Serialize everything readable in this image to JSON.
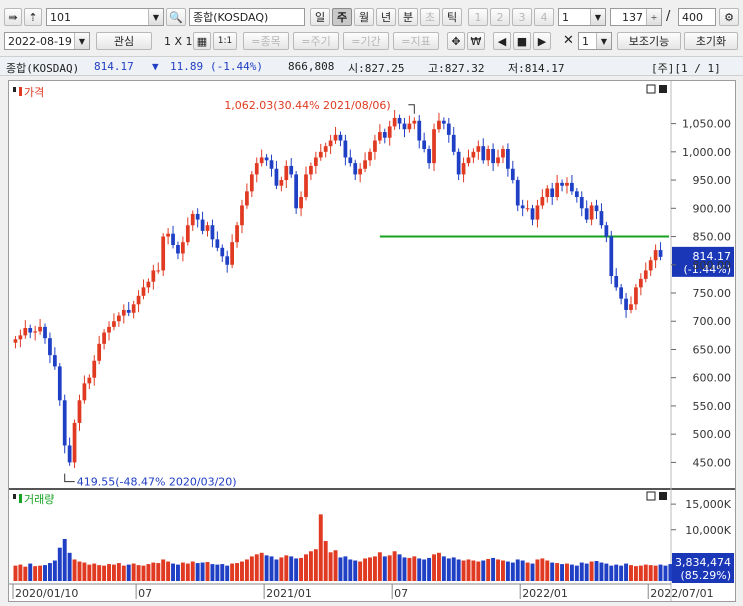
{
  "toolbar": {
    "code": "101",
    "name": "종합(KOSDAQ)",
    "periods": [
      "일",
      "주",
      "월",
      "년",
      "분",
      "초",
      "틱"
    ],
    "active_period": "주",
    "numbers": [
      "1",
      "2",
      "3",
      "4"
    ],
    "n_select": "1",
    "count": "137",
    "total": "400",
    "date": "2022-08-19",
    "watch_label": "관심",
    "grid_label": "1 X 1",
    "one_to_one": "1:1",
    "filter_buttons": [
      "=종목",
      "=주기",
      "=기간",
      "=지표"
    ],
    "x_select": "1",
    "aux_button": "보조기능",
    "reset_button": "초기화"
  },
  "info": {
    "name": "종합(KOSDAQ)",
    "price": "814.17",
    "arrow": "▼",
    "change": "11.89",
    "change_pct": "(-1.44%)",
    "volume": "866,808",
    "open": "시:827.25",
    "high": "고:827.32",
    "low": "저:814.17",
    "page": "[주][1 / 1]"
  },
  "price_panel": {
    "title": "가격"
  },
  "volume_panel": {
    "title": "거래량"
  },
  "colors": {
    "up": "#e03a22",
    "down": "#1f3fc4",
    "hline": "#15a321",
    "label_bg": "#1a37b8"
  },
  "chart_data": {
    "type": "candlestick",
    "title": "가격",
    "ylim": [
      410,
      1090
    ],
    "yticks": [
      450,
      500,
      550,
      600,
      650,
      700,
      750,
      800,
      850,
      900,
      950,
      1000,
      1050
    ],
    "ytick_labels": [
      "450.00",
      "500.00",
      "550.00",
      "600.00",
      "650.00",
      "700.00",
      "750.00",
      "800.00",
      "850.00",
      "900.00",
      "950.00",
      "1,000.00",
      "1,050.00"
    ],
    "x_labels": [
      {
        "index": 0,
        "label": "2020/01/10"
      },
      {
        "index": 25,
        "label": "07"
      },
      {
        "index": 51,
        "label": "2021/01"
      },
      {
        "index": 77,
        "label": "07"
      },
      {
        "index": 103,
        "label": "2022/01"
      },
      {
        "index": 129,
        "label": "2022/07/01"
      }
    ],
    "annotations": [
      {
        "text": "1,062.03(30.44% 2021/08/06)",
        "index": 81,
        "value": 1062.03
      },
      {
        "text": "419.55(-48.47% 2020/03/20)",
        "index": 10,
        "value": 419.55
      }
    ],
    "horizontal_line": 850,
    "last_price_label": "814.17",
    "last_change_label": "(-1.44%)",
    "close": [
      668,
      675,
      688,
      680,
      682,
      690,
      670,
      640,
      620,
      560,
      480,
      450,
      520,
      560,
      590,
      600,
      630,
      660,
      680,
      690,
      700,
      710,
      720,
      715,
      730,
      745,
      760,
      770,
      790,
      790,
      850,
      855,
      835,
      820,
      840,
      870,
      890,
      880,
      860,
      870,
      845,
      830,
      815,
      800,
      840,
      870,
      905,
      930,
      960,
      980,
      990,
      985,
      970,
      940,
      950,
      975,
      960,
      900,
      920,
      960,
      975,
      990,
      1000,
      1010,
      1020,
      1030,
      1020,
      990,
      980,
      960,
      970,
      985,
      1000,
      1020,
      1035,
      1025,
      1045,
      1060,
      1050,
      1040,
      1050,
      1055,
      1020,
      1005,
      980,
      1040,
      1055,
      1050,
      1030,
      1000,
      960,
      980,
      990,
      1000,
      1010,
      985,
      1005,
      980,
      990,
      1005,
      970,
      950,
      905,
      900,
      900,
      880,
      905,
      920,
      935,
      920,
      945,
      940,
      945,
      930,
      920,
      900,
      880,
      905,
      895,
      870,
      850,
      780,
      760,
      740,
      720,
      730,
      760,
      775,
      790,
      808,
      826,
      814
    ],
    "volume": [
      3.0,
      3.2,
      2.8,
      3.4,
      2.9,
      3.0,
      3.1,
      3.5,
      4.0,
      6.5,
      8.2,
      5.5,
      4.2,
      3.8,
      3.6,
      3.2,
      3.4,
      3.1,
      3.0,
      3.3,
      3.2,
      3.5,
      3.0,
      3.2,
      3.4,
      3.1,
      3.0,
      3.3,
      3.6,
      3.5,
      4.2,
      3.8,
      3.4,
      3.2,
      3.6,
      3.4,
      3.8,
      3.5,
      3.6,
      3.7,
      3.3,
      3.2,
      3.3,
      3.0,
      3.4,
      3.5,
      3.8,
      4.2,
      4.8,
      5.2,
      5.5,
      5.0,
      4.8,
      4.2,
      4.6,
      5.0,
      4.8,
      4.4,
      4.5,
      5.2,
      5.8,
      6.2,
      13.0,
      7.8,
      5.6,
      6.0,
      4.6,
      4.8,
      4.2,
      4.0,
      3.8,
      4.4,
      4.6,
      4.8,
      5.6,
      4.8,
      5.0,
      5.8,
      5.2,
      4.6,
      4.5,
      4.8,
      4.4,
      4.2,
      4.5,
      5.2,
      5.5,
      4.8,
      4.4,
      4.6,
      4.2,
      4.0,
      4.2,
      4.0,
      3.8,
      4.0,
      4.3,
      4.5,
      4.2,
      4.0,
      3.8,
      3.6,
      4.2,
      4.0,
      3.6,
      3.4,
      4.2,
      4.4,
      4.0,
      3.6,
      3.5,
      3.3,
      3.4,
      3.2,
      3.0,
      3.6,
      3.4,
      3.8,
      3.9,
      3.6,
      3.4,
      3.0,
      3.2,
      3.0,
      3.4,
      3.1,
      2.9,
      3.0,
      3.2,
      3.1,
      3.0,
      3.2,
      3.0,
      3.3,
      3.1,
      3.0,
      2.8
    ],
    "volume_ticks": [
      10000,
      15000
    ],
    "volume_tick_labels": [
      "10,000K",
      "15,000K"
    ],
    "last_volume_label": "3,834,474",
    "last_volume_pct": "(85.29%)"
  }
}
